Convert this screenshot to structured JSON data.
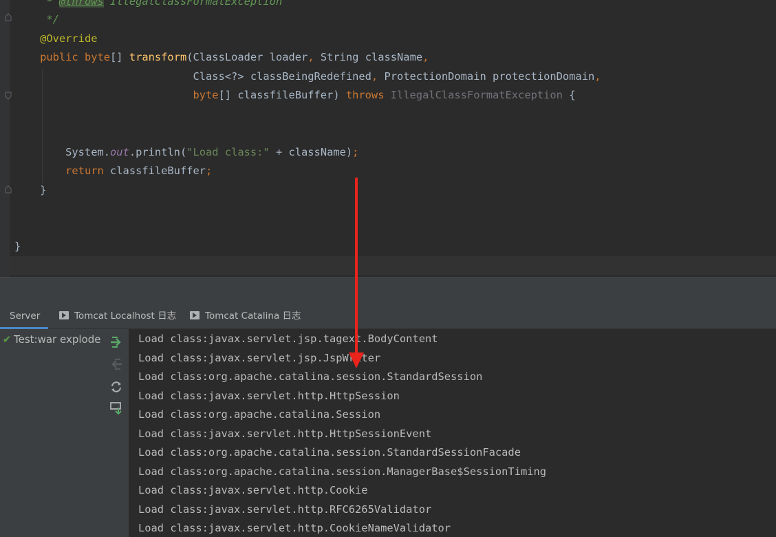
{
  "editor": {
    "lines": [
      {
        "parts": [
          [
            "c-com",
            "     * "
          ],
          [
            "c-tag",
            "@throws"
          ],
          [
            "c-ital",
            " IllegalClassFormatException"
          ]
        ]
      },
      {
        "parts": [
          [
            "c-com",
            "     */"
          ]
        ]
      },
      {
        "parts": [
          [
            "",
            "    "
          ],
          [
            "c-ann",
            "@Override"
          ]
        ]
      },
      {
        "parts": [
          [
            "",
            "    "
          ],
          [
            "c-kw",
            "public byte"
          ],
          [
            "",
            "[] "
          ],
          [
            "c-fn",
            "transform"
          ],
          [
            "",
            "(ClassLoader loader"
          ],
          [
            "c-kw",
            ", "
          ],
          [
            "",
            "String className"
          ],
          [
            "c-kw",
            ","
          ]
        ]
      },
      {
        "parts": [
          [
            "",
            "                            Class<?> classBeingRedefined"
          ],
          [
            "c-kw",
            ", "
          ],
          [
            "",
            "ProtectionDomain protectionDomain"
          ],
          [
            "c-kw",
            ","
          ]
        ]
      },
      {
        "parts": [
          [
            "",
            "                            "
          ],
          [
            "c-kw",
            "byte"
          ],
          [
            "",
            "[] classfileBuffer) "
          ],
          [
            "c-kw",
            "throws "
          ],
          [
            "c-unused",
            "IllegalClassFormatException"
          ],
          [
            "",
            " {"
          ]
        ]
      },
      {
        "parts": [
          [
            "",
            ""
          ]
        ]
      },
      {
        "parts": [
          [
            "",
            ""
          ]
        ]
      },
      {
        "parts": [
          [
            "",
            "        System."
          ],
          [
            "c-fld",
            "out"
          ],
          [
            "",
            ".println("
          ],
          [
            "c-str",
            "\"Load class:\""
          ],
          [
            "",
            " + className)"
          ],
          [
            "c-kw",
            ";"
          ]
        ]
      },
      {
        "parts": [
          [
            "",
            "        "
          ],
          [
            "c-kw",
            "return "
          ],
          [
            "",
            "classfileBuffer"
          ],
          [
            "c-kw",
            ";"
          ]
        ]
      },
      {
        "parts": [
          [
            "",
            "    }"
          ]
        ]
      },
      {
        "parts": [
          [
            "",
            ""
          ]
        ]
      },
      {
        "parts": [
          [
            "",
            ""
          ]
        ]
      },
      {
        "parts": [
          [
            "",
            "}"
          ]
        ]
      }
    ]
  },
  "tabs": [
    {
      "label": "Server",
      "icon": "none",
      "active": true
    },
    {
      "label": "Tomcat Localhost 日志",
      "icon": "log-icon",
      "active": false
    },
    {
      "label": "Tomcat Catalina 日志",
      "icon": "log-icon",
      "active": false
    }
  ],
  "server_panel": {
    "item_label": "Test:war explode",
    "status_icon": "check-icon",
    "buttons": [
      "deploy-icon",
      "undeploy-icon",
      "refresh-icon",
      "dump-icon"
    ]
  },
  "console": {
    "lines": [
      "Load class:javax.servlet.jsp.tagext.BodyContent",
      "Load class:javax.servlet.jsp.JspWriter",
      "Load class:org.apache.catalina.session.StandardSession",
      "Load class:javax.servlet.http.HttpSession",
      "Load class:org.apache.catalina.Session",
      "Load class:javax.servlet.http.HttpSessionEvent",
      "Load class:org.apache.catalina.session.StandardSessionFacade",
      "Load class:org.apache.catalina.session.ManagerBase$SessionTiming",
      "Load class:javax.servlet.http.Cookie",
      "Load class:javax.servlet.http.RFC6265Validator",
      "Load class:javax.servlet.http.CookieNameValidator"
    ]
  },
  "annotation": {
    "arrow_color": "#e8241c"
  },
  "colors": {
    "editor_bg": "#2b2b2b",
    "panel_bg": "#3c3f41",
    "accent": "#4a88c7"
  }
}
